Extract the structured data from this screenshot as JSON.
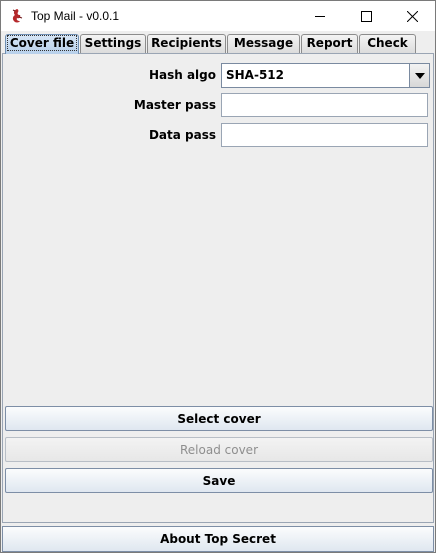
{
  "window": {
    "title": "Top Mail - v0.0.1",
    "minimize_glyph": "—",
    "app_icon": "dragon-icon"
  },
  "tabs": [
    {
      "label": "Cover file",
      "active": true
    },
    {
      "label": "Settings",
      "active": false
    },
    {
      "label": "Recipients",
      "active": false
    },
    {
      "label": "Message",
      "active": false
    },
    {
      "label": "Report",
      "active": false
    },
    {
      "label": "Check",
      "active": false
    }
  ],
  "form": {
    "hash_algo_label": "Hash algo",
    "hash_algo_value": "SHA-512",
    "master_pass_label": "Master pass",
    "master_pass_value": "",
    "data_pass_label": "Data pass",
    "data_pass_value": ""
  },
  "buttons": {
    "select_cover": "Select cover",
    "reload_cover": "Reload cover",
    "save": "Save",
    "about": "About Top Secret"
  },
  "colors": {
    "active_tab": "#b8d0ea",
    "panel_bg": "#eeeeee",
    "disabled_text": "#8e8e8e"
  }
}
